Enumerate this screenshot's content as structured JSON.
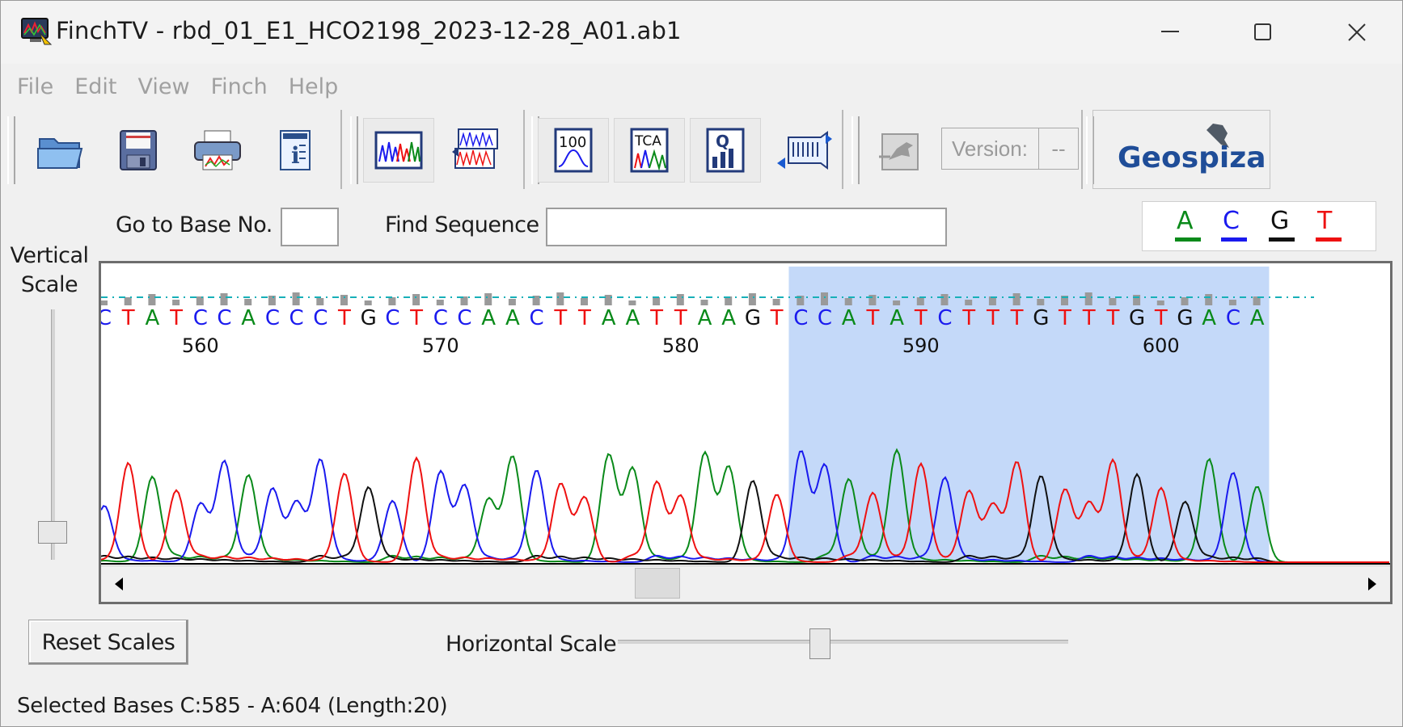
{
  "window": {
    "title": "FinchTV - rbd_01_E1_HCO2198_2023-12-28_A01.ab1"
  },
  "menu": [
    "File",
    "Edit",
    "View",
    "Finch",
    "Help"
  ],
  "toolbar": {
    "buttons": [
      "open-icon",
      "save-icon",
      "print-icon",
      "info-icon",
      "chromatogram-view-icon",
      "multi-trace-icon",
      "quality-100-icon",
      "tca-view-icon",
      "quality-chart-icon",
      "sequence-scroll-icon",
      "blast-icon"
    ],
    "version_label": "Version:",
    "version_value": "--",
    "logo_text": "Geospiza"
  },
  "controls": {
    "goto_label": "Go to Base No.",
    "goto_value": "",
    "find_label": "Find Sequence",
    "find_value": ""
  },
  "legend": [
    {
      "base": "A",
      "color": "#0a8a1a"
    },
    {
      "base": "C",
      "color": "#1a1aee"
    },
    {
      "base": "G",
      "color": "#111111"
    },
    {
      "base": "T",
      "color": "#ee1111"
    }
  ],
  "vertical_scale_label_1": "Vertical",
  "vertical_scale_label_2": "Scale",
  "sequence": {
    "bases": "CTATCCACCCTGCTCCAACTTAATTAAGTCCATATCTTTGTTTGTGACA",
    "position_labels": [
      "560",
      "570",
      "580",
      "590",
      "600"
    ],
    "selection": {
      "start": 585,
      "end": 604
    }
  },
  "reset_button": "Reset Scales",
  "horizontal_scale_label": "Horizontal Scale",
  "status": "Selected Bases C:585 - A:604  (Length:20)"
}
